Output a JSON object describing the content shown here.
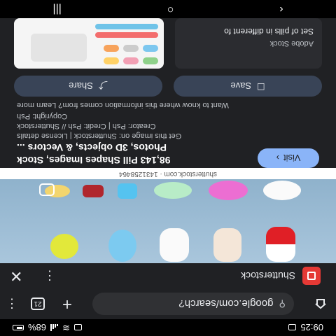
{
  "status_bar": {
    "time": "09:25",
    "battery_percent": "68%"
  },
  "browser": {
    "url": "google.com/search?",
    "tab_count": "21"
  },
  "source": {
    "name": "Shutterstock"
  },
  "image": {
    "caption": "shutterstock.com · 1431258464"
  },
  "result": {
    "visit_label": "Visit",
    "title_line1": "98,143 Pill Shapes Images, Stock",
    "title_line2": "Photos, 3D objects, & Vectors ...",
    "license_line": "Get this image on: Shutterstock | License details",
    "creator_line": "Creator: Psh | Credit: Psh // Shutterstock",
    "copyright_line": "Copyright: Psh",
    "want_to_know": "Want to know where this information comes from? Learn more",
    "save_label": "Save",
    "share_label": "Share"
  },
  "related": {
    "title": "Set of pills in different fo",
    "source": "Adobe Stock"
  },
  "colors": {
    "accent": "#8ab4f8",
    "background": "#202124",
    "button_bg": "#394457",
    "source_logo": "#e53935"
  }
}
